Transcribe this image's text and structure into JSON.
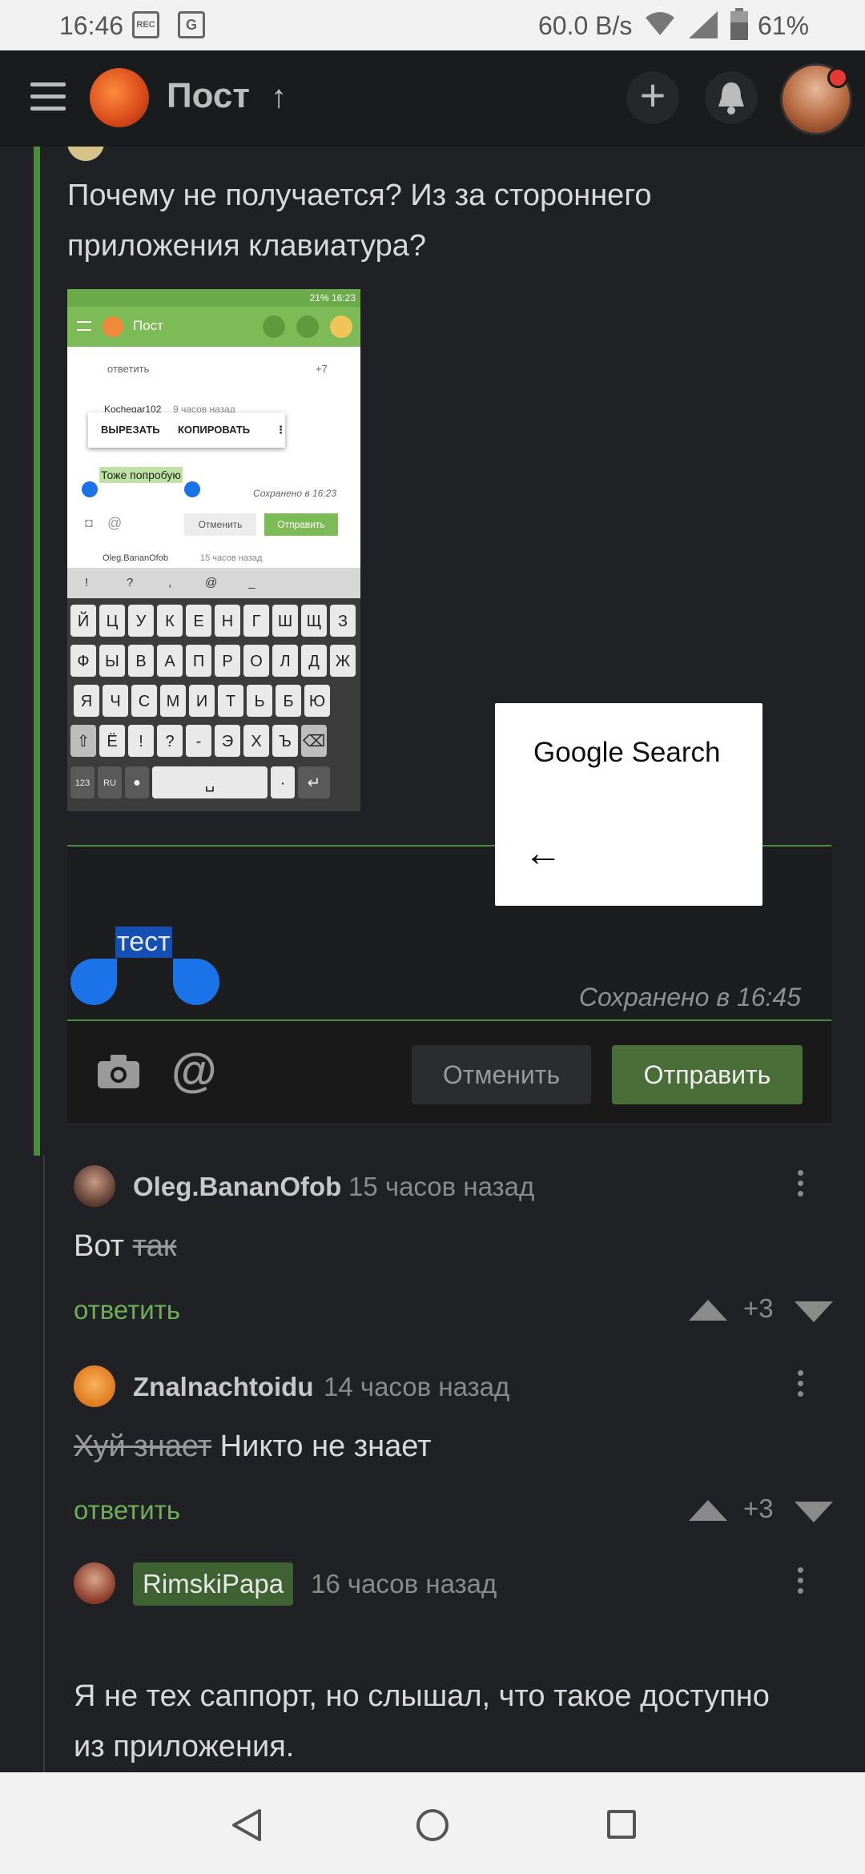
{
  "status_bar": {
    "time": "16:46",
    "rec_label": "REC",
    "net_speed": "60.0 B/s",
    "battery": "61%"
  },
  "app_bar": {
    "title": "Пост",
    "icons": [
      "menu-icon",
      "pikabu-logo",
      "arrow-up-icon",
      "plus-icon",
      "bell-icon",
      "avatar"
    ]
  },
  "question": {
    "text": "Почему не получается? Из за стороннего приложения клавиатура?"
  },
  "embedded_screenshot": {
    "status_time": "21% 16:23",
    "title": "Пост",
    "reply_label": "ответить",
    "score": "+7",
    "user": "Kochegar102",
    "user_time": "9 часов назад",
    "ctx_cut": "ВЫРЕЗАТЬ",
    "ctx_copy": "КОПИРОВАТЬ",
    "selected_text": "Тоже попробую",
    "saved": "Сохранено в 16:23",
    "cancel": "Отменить",
    "send": "Отправить",
    "next_user": "Oleg.BananOfob",
    "next_time": "15 часов назад",
    "sym_row": [
      "!",
      "?",
      ",",
      "@",
      "_"
    ],
    "row1": [
      "Й",
      "Ц",
      "У",
      "К",
      "Е",
      "Н",
      "Г",
      "Ш",
      "Щ",
      "З"
    ],
    "row2": [
      "Ф",
      "Ы",
      "В",
      "А",
      "П",
      "Р",
      "О",
      "Л",
      "Д",
      "Ж"
    ],
    "row3": [
      "Я",
      "Ч",
      "С",
      "М",
      "И",
      "Т",
      "Ь",
      "Б",
      "Ю"
    ],
    "row4": [
      "Ё",
      "!",
      "?",
      "-",
      "Э",
      "Х",
      "Ъ"
    ],
    "key_123": "123",
    "key_lang": "RU"
  },
  "editor": {
    "text": "тест",
    "saved_label": "Сохранено в 16:45",
    "cancel_label": "Отменить",
    "send_label": "Отправить"
  },
  "popup": {
    "title": "Google Search"
  },
  "comments": [
    {
      "user": "Oleg.BananOfob",
      "time": "15 часов назад",
      "text_plain": "Вот ",
      "text_strike": "так",
      "reply_label": "ответить",
      "score": "+3"
    },
    {
      "user": "Znalnachtoidu",
      "time": "14 часов назад",
      "text_strike": "Хуй знает",
      "text_plain": " Никто не знает",
      "reply_label": "ответить",
      "score": "+3"
    },
    {
      "user": "RimskiPapa",
      "time": "16 часов назад",
      "text": "Я не тех саппорт, но слышал, что такое доступно из приложения."
    }
  ],
  "colors": {
    "accent_green": "#4c8c3c",
    "reply_green": "#6fae58",
    "selection_blue": "#1450b4"
  }
}
